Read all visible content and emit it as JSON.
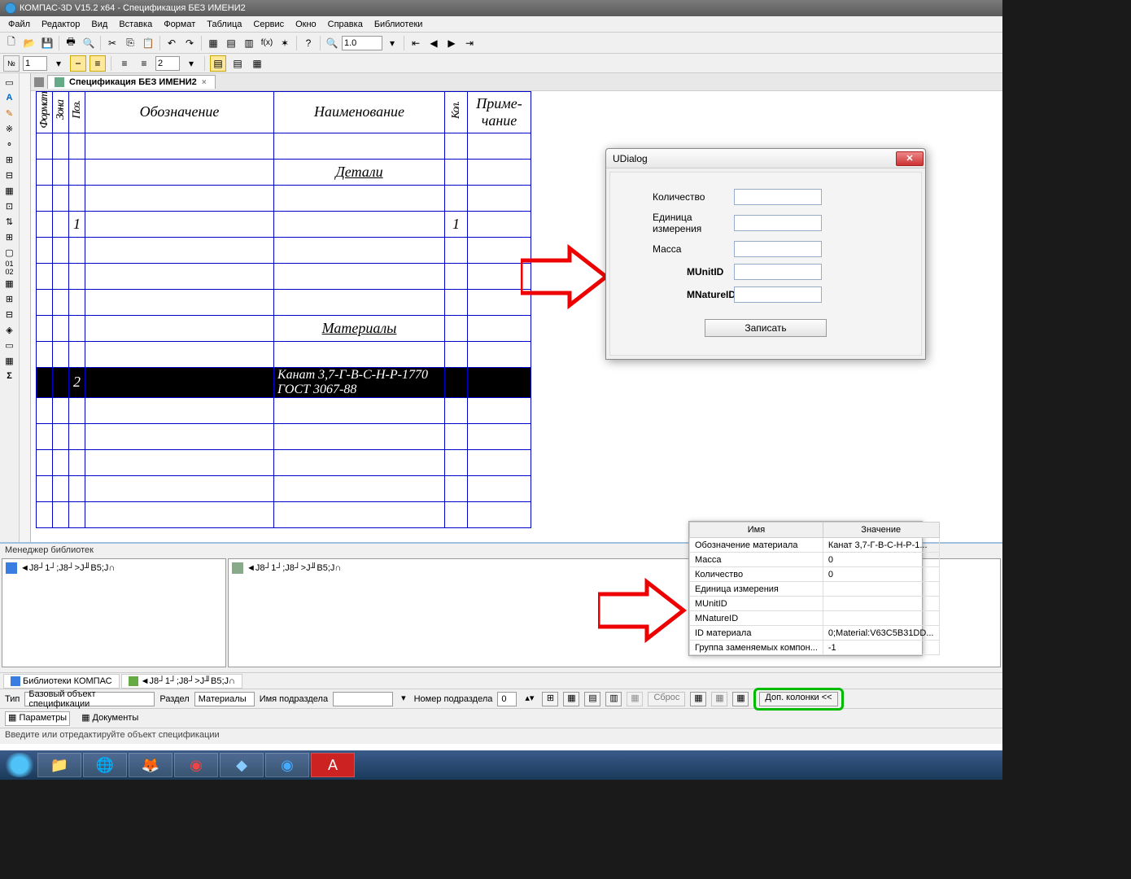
{
  "title": "КОМПАС-3D V15.2  x64 - Спецификация БЕЗ ИМЕНИ2",
  "menu": [
    "Файл",
    "Редактор",
    "Вид",
    "Вставка",
    "Формат",
    "Таблица",
    "Сервис",
    "Окно",
    "Справка",
    "Библиотеки"
  ],
  "zoom": "1.0",
  "tb2_num": "1",
  "tb2_lines": "2",
  "doc_tab": "Спецификация БЕЗ ИМЕНИ2",
  "spec_headers": {
    "format": "Формат",
    "zona": "Зона",
    "poz": "Поз.",
    "oboz": "Обозначение",
    "naim": "Наименование",
    "kol": "Кол.",
    "prim": "Приме-\nчание"
  },
  "spec_rows": {
    "detali": "Детали",
    "pos1": "1",
    "kol1": "1",
    "materials": "Материалы",
    "pos2": "2",
    "item2": "Канат 3,7-Г-В-С-Н-Р-1770 ГОСТ 3067-88"
  },
  "lib_title": "Менеджер библиотек",
  "lib_item": "◄J8┘1┘;J8┘>J╜B5;J∩",
  "lib_tabs": {
    "kompas": "Библиотеки КОМПАС",
    "other": "◄J8┘1┘;J8┘>J╜B5;J∩"
  },
  "bottom1": {
    "tip_label": "Тип",
    "tip_val": "Базовый объект спецификации",
    "razdel_label": "Раздел",
    "razdel_val": "Материалы",
    "imyap_label": "Имя подраздела",
    "imyap_val": "",
    "nomp_label": "Номер подраздела",
    "nomp_val": "0",
    "sbros": "Сброс",
    "dop": "Доп. колонки  <<"
  },
  "bottom2": {
    "params": "Параметры",
    "docs": "Документы"
  },
  "status": "Введите или отредактируйте объект спецификации",
  "udialog": {
    "title": "UDialog",
    "f1": "Количество",
    "f2": "Единица измерения",
    "f3": "Масса",
    "f4": "MUnitID",
    "f5": "MNatureID",
    "save": "Записать"
  },
  "props": {
    "h1": "Имя",
    "h2": "Значение",
    "rows": [
      {
        "n": "Обозначение материала",
        "v": "Канат 3,7-Г-В-С-Н-Р-1..."
      },
      {
        "n": "Масса",
        "v": "0"
      },
      {
        "n": "Количество",
        "v": "0"
      },
      {
        "n": "Единица измерения",
        "v": ""
      },
      {
        "n": "MUnitID",
        "v": ""
      },
      {
        "n": "MNatureID",
        "v": ""
      },
      {
        "n": "ID материала",
        "v": "0;Material:V63C5B31DD..."
      },
      {
        "n": "Группа заменяемых компон...",
        "v": "-1"
      }
    ]
  }
}
